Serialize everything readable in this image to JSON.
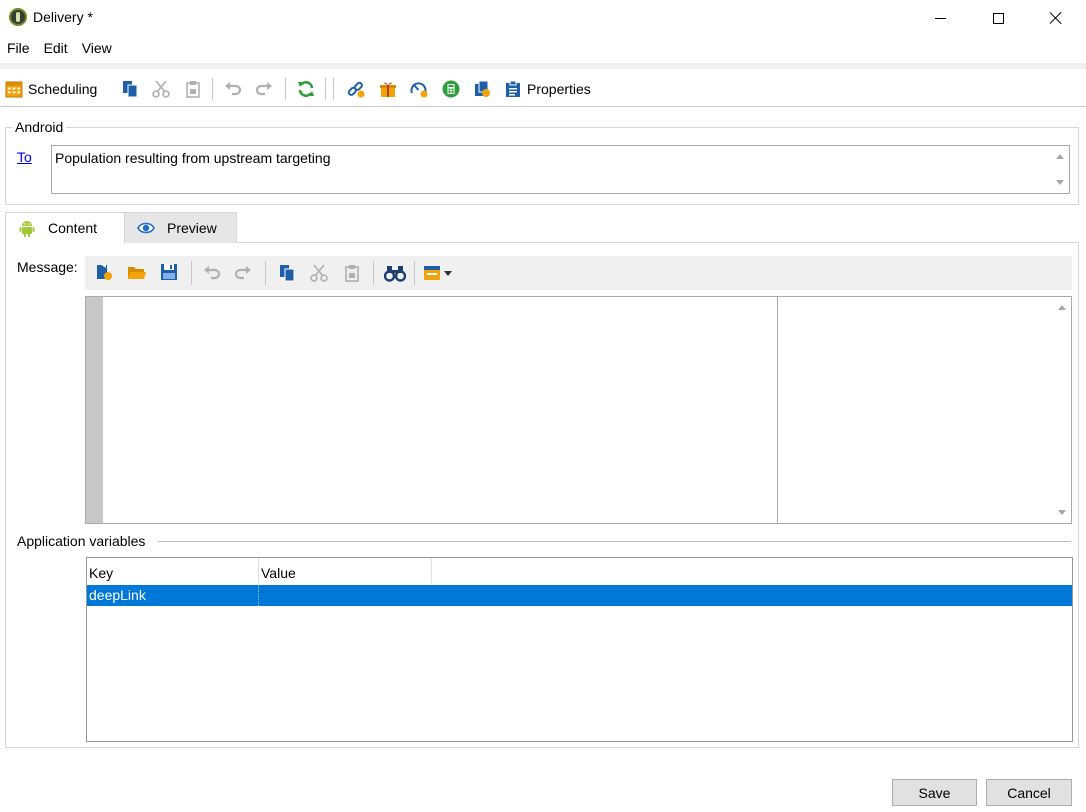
{
  "window": {
    "title": "Delivery *"
  },
  "menu": [
    "File",
    "Edit",
    "View"
  ],
  "toolbar": {
    "scheduling_label": "Scheduling",
    "properties_label": "Properties"
  },
  "target": {
    "legend": "Android",
    "to_label": "To",
    "to_value": "Population resulting from upstream targeting"
  },
  "tabs": [
    {
      "label": "Content",
      "icon": "android-icon"
    },
    {
      "label": "Preview",
      "icon": "eye-icon"
    }
  ],
  "message": {
    "label": "Message:"
  },
  "app_vars": {
    "label": "Application variables",
    "columns": [
      "Key",
      "Value"
    ],
    "rows": [
      {
        "key": "deepLink",
        "value": ""
      }
    ]
  },
  "buttons": {
    "save": "Save",
    "cancel": "Cancel"
  },
  "colors": {
    "selection": "#0078d7",
    "accent_green": "#2e9e3a",
    "accent_orange": "#f0a30a",
    "accent_blue": "#1f5fa8"
  }
}
